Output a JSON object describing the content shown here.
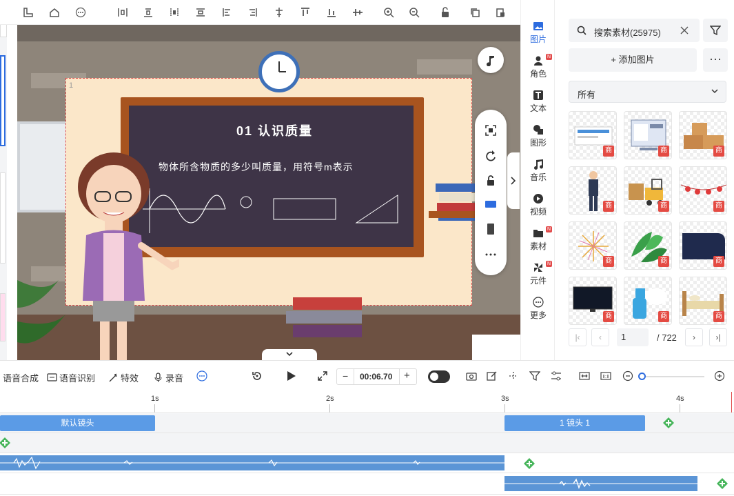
{
  "toolbar": {
    "icons": [
      "ruler-icon",
      "home-icon",
      "more-circle-icon",
      "align-left-edge-icon",
      "align-center-h-icon",
      "align-right-edge-icon",
      "distribute-h-icon",
      "align-left-icon",
      "align-right-icon",
      "align-vcenter-icon",
      "align-top-icon",
      "align-bottom-icon",
      "distribute-v-icon",
      "zoom-in-icon",
      "zoom-out-icon",
      "unlock-icon",
      "copy-icon",
      "paste-icon"
    ]
  },
  "canvas": {
    "scene_number": "1",
    "board_title": "01 认识质量",
    "board_subtitle": "物体所含物质的多少叫质量，用符号m表示"
  },
  "categories": [
    {
      "label": "图片",
      "icon": "image-icon",
      "active": true,
      "new": false
    },
    {
      "label": "角色",
      "icon": "person-icon",
      "active": false,
      "new": true
    },
    {
      "label": "文本",
      "icon": "text-icon",
      "active": false,
      "new": false
    },
    {
      "label": "图形",
      "icon": "shape-icon",
      "active": false,
      "new": false
    },
    {
      "label": "音乐",
      "icon": "music-icon",
      "active": false,
      "new": false
    },
    {
      "label": "视频",
      "icon": "video-icon",
      "active": false,
      "new": false
    },
    {
      "label": "素材",
      "icon": "folder-icon",
      "active": false,
      "new": true
    },
    {
      "label": "元件",
      "icon": "pinwheel-icon",
      "active": false,
      "new": true
    },
    {
      "label": "更多",
      "icon": "more-icon",
      "active": false,
      "new": false
    }
  ],
  "new_badge": "N",
  "asset_panel": {
    "search_text": "搜索素材(25975)",
    "add_image_label": "添加图片",
    "filter_select": "所有",
    "more_label": "···",
    "premium_badge": "商",
    "thumbs": [
      "web-banner",
      "web-browser",
      "cardboard-boxes",
      "businessman",
      "forklift",
      "lantern-string",
      "fireworks",
      "green-leaves",
      "dark-panel",
      "tv-screen",
      "spray-bottle",
      "bed"
    ],
    "page_current": "1",
    "page_total": "/ 722"
  },
  "timeline_toolbar": {
    "tts_label": "语音合成",
    "asr_label": "语音识别",
    "fx_label": "特效",
    "record_label": "录音",
    "time_value": "00:06.70",
    "minus": "−",
    "plus": "+"
  },
  "timeline": {
    "ticks": [
      "1s",
      "2s",
      "3s",
      "4s"
    ],
    "clip_default": "默认镜头",
    "clip_scene1": "1 镜头 1"
  }
}
